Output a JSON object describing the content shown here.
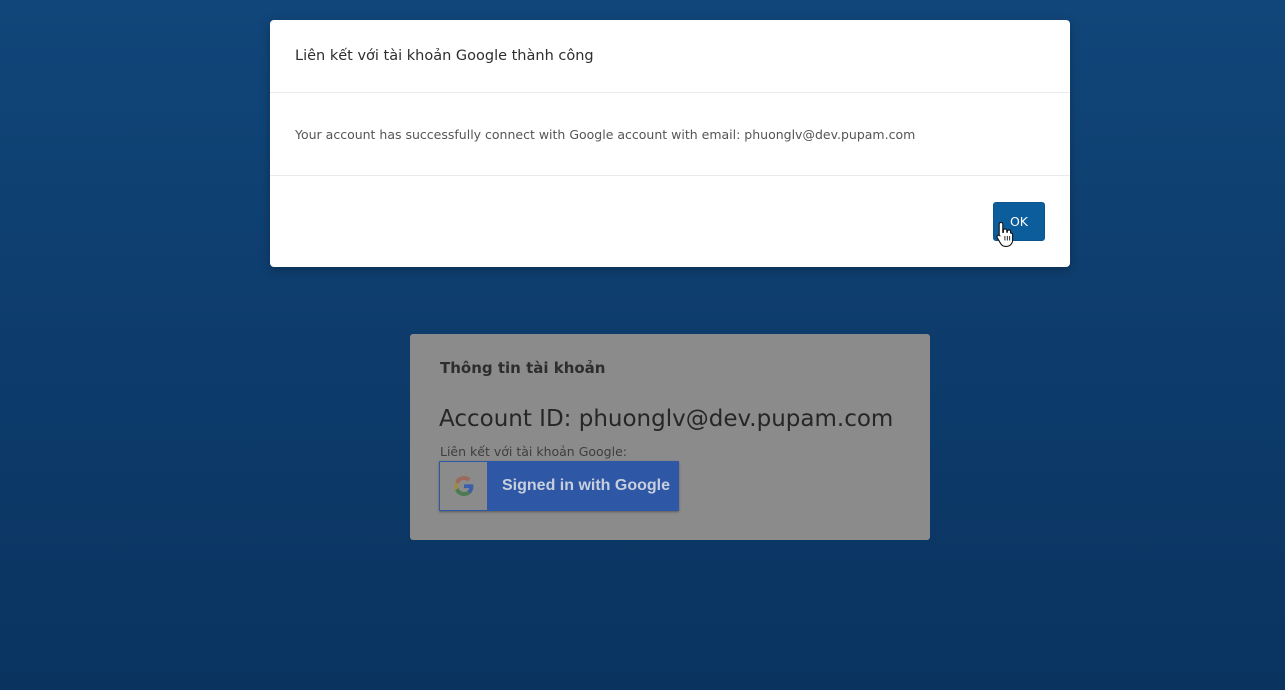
{
  "modal": {
    "title": "Liên kết với tài khoản Google thành công",
    "message": "Your account has successfully connect with Google account with email: phuonglv@dev.pupam.com",
    "ok_label": "OK"
  },
  "account_card": {
    "title": "Thông tin tài khoản",
    "account_id": "Account ID: phuonglv@dev.pupam.com",
    "google_link_label": "Liên kết với tài khoản Google:",
    "google_button_label": "Signed in with Google"
  },
  "colors": {
    "primary_button": "#0b5d9c",
    "google_button": "#2e57a6",
    "background_top": "#11467a",
    "background_bottom": "#0a3360"
  },
  "icons": {
    "google": "google-g-icon",
    "cursor": "hand-pointer-icon"
  }
}
